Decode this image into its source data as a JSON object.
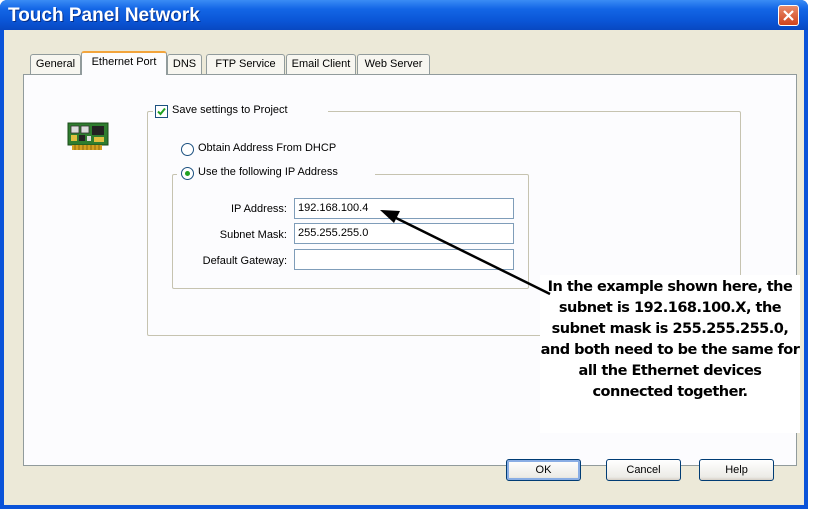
{
  "window": {
    "title": "Touch Panel Network"
  },
  "tabs": [
    {
      "label": "General",
      "active": false
    },
    {
      "label": "Ethernet Port",
      "active": true
    },
    {
      "label": "DNS",
      "active": false
    },
    {
      "label": "FTP Service",
      "active": false
    },
    {
      "label": "Email Client",
      "active": false
    },
    {
      "label": "Web Server",
      "active": false
    }
  ],
  "ethernet": {
    "save_label": "Save settings to Project",
    "save_checked": true,
    "dhcp_label": "Obtain Address From DHCP",
    "dhcp_selected": false,
    "static_label": "Use the following IP Address",
    "static_selected": true,
    "fields": {
      "ip_label": "IP Address:",
      "ip_value": "192.168.100.4",
      "mask_label": "Subnet Mask:",
      "mask_value": "255.255.255.0",
      "gateway_label": "Default Gateway:",
      "gateway_value": ""
    }
  },
  "buttons": {
    "ok": "OK",
    "cancel": "Cancel",
    "help": "Help"
  },
  "annotation": {
    "text": "In the example shown here, the subnet is 192.168.100.X, the subnet mask is 255.255.255.0, and both need to be the same for all the Ethernet devices connected together."
  },
  "colors": {
    "titlebar": "#0a55d6",
    "dialog_face": "#ece9d8",
    "active_tab_accent": "#f2a43c",
    "radio_dot": "#21a121",
    "close_button": "#d0431c"
  },
  "icons": {
    "network_card": "network-card-icon",
    "close": "close-icon"
  }
}
